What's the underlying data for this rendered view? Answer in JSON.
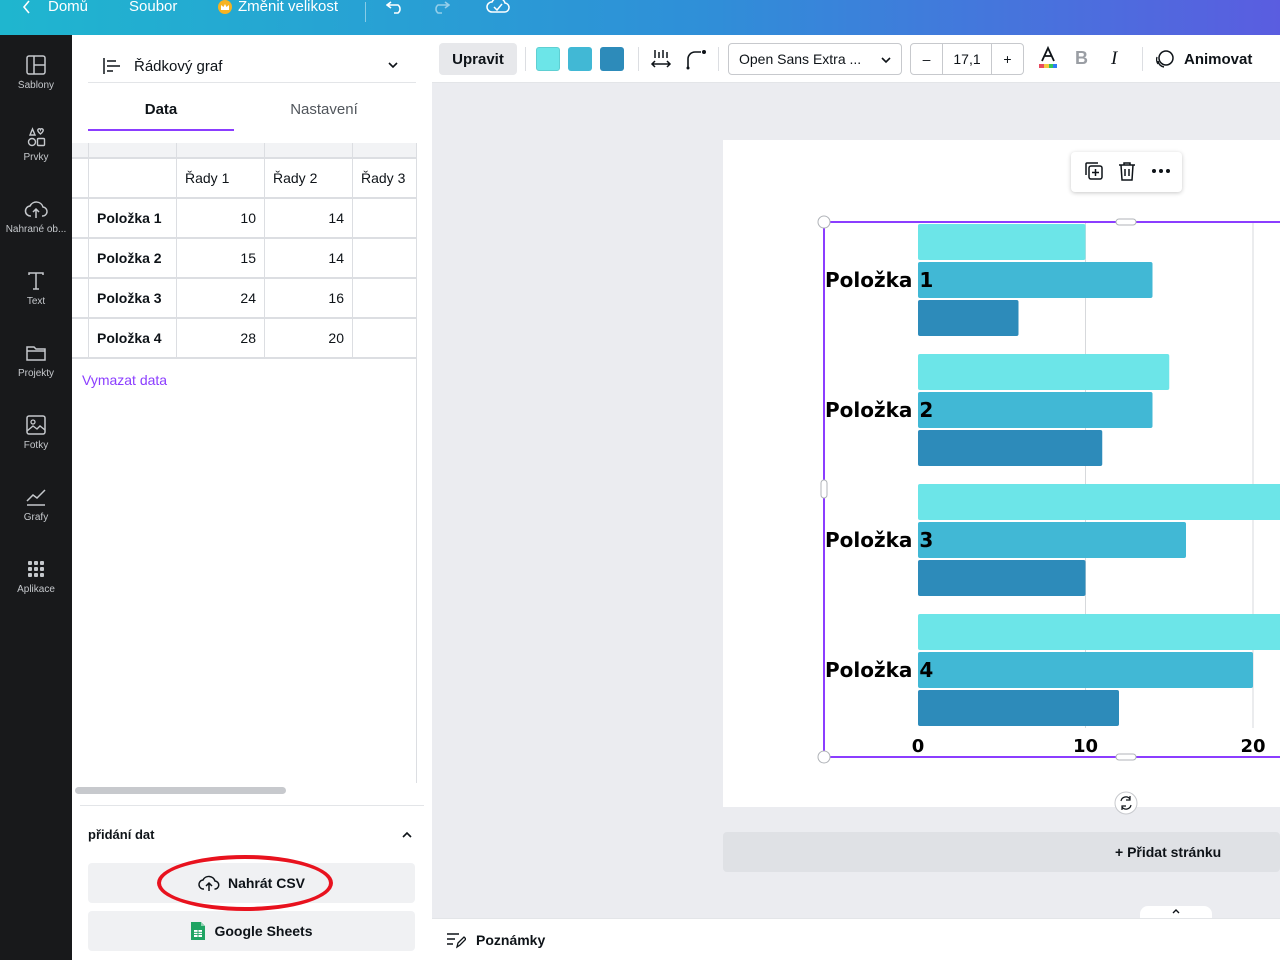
{
  "topbar": {
    "home_label": "Domů",
    "file_label": "Soubor",
    "resize_label": "Změnit velikost"
  },
  "rail": {
    "items": [
      {
        "label": "Šablony",
        "icon": "templates-icon"
      },
      {
        "label": "Prvky",
        "icon": "elements-icon"
      },
      {
        "label": "Nahrané ob...",
        "icon": "upload-cloud-icon"
      },
      {
        "label": "Text",
        "icon": "text-icon"
      },
      {
        "label": "Projekty",
        "icon": "folder-icon"
      },
      {
        "label": "Fotky",
        "icon": "photo-icon"
      },
      {
        "label": "Grafy",
        "icon": "charts-icon"
      },
      {
        "label": "Aplikace",
        "icon": "apps-icon"
      }
    ]
  },
  "panel": {
    "chart_type_label": "Řádkový graf",
    "tabs": [
      "Data",
      "Nastavení"
    ],
    "table": {
      "columns": [
        "Řady 1",
        "Řady 2",
        "Řady 3"
      ],
      "rows": [
        {
          "label": "Položka 1",
          "v1": "10",
          "v2": "14"
        },
        {
          "label": "Položka 2",
          "v1": "15",
          "v2": "14"
        },
        {
          "label": "Položka 3",
          "v1": "24",
          "v2": "16"
        },
        {
          "label": "Položka 4",
          "v1": "28",
          "v2": "20"
        }
      ]
    },
    "clear_data_label": "Vymazat data",
    "add_data_title": "přidání dat",
    "upload_csv_label": "Nahrát CSV",
    "google_sheets_label": "Google Sheets"
  },
  "toolbar": {
    "edit_label": "Upravit",
    "swatches": [
      "#6ce5e8",
      "#41b8d5",
      "#2d8bba"
    ],
    "font_name": "Open Sans Extra ...",
    "font_size": "17,1",
    "minus": "–",
    "plus": "+",
    "bold": "B",
    "italic": "I",
    "animate_label": "Animovat"
  },
  "canvas": {
    "add_page_label": "+ Přidat stránku",
    "notes_label": "Poznámky"
  },
  "chart_data": {
    "type": "bar",
    "orientation": "horizontal",
    "categories": [
      "Položka 1",
      "Položka 2",
      "Položka 3",
      "Položka 4"
    ],
    "series": [
      {
        "values": [
          10,
          15,
          24,
          28
        ],
        "color": "#6ce5e8"
      },
      {
        "values": [
          14,
          14,
          16,
          20
        ],
        "color": "#41b8d5"
      },
      {
        "values": [
          6,
          11,
          10,
          12
        ],
        "color": "#2d8bba"
      }
    ],
    "x_ticks": [
      "0",
      "10",
      "20"
    ],
    "xlim_visible": [
      0,
      21.7
    ],
    "grid": true
  }
}
